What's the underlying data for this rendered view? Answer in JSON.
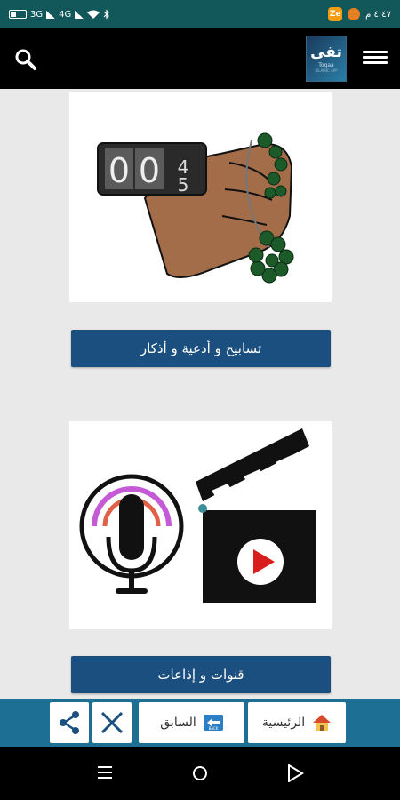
{
  "status_bar": {
    "time": "٤:٤٧ م",
    "network_1": "3G",
    "network_2": "4G",
    "badge_a": "Ze"
  },
  "app_bar": {
    "logo_text": "تقى",
    "logo_en": "Toqaa",
    "logo_sub": "ISLAMIC APP"
  },
  "main": {
    "cards": [
      {
        "button_label": "تسابيح و أدعية و أذكار",
        "image_icon": "tasbih-counter-image"
      },
      {
        "button_label": "قنوات و إذاعات",
        "image_icon": "radio-tv-channels-image"
      }
    ]
  },
  "toolbar": {
    "home_label": "الرئيسية",
    "back_label": "السابق",
    "back_icon_text": "BACK"
  },
  "colors": {
    "status_bar": "#12585a",
    "button_blue": "#1b4f7f",
    "toolbar": "#1d6f93",
    "content_bg": "#e9e9e9"
  }
}
